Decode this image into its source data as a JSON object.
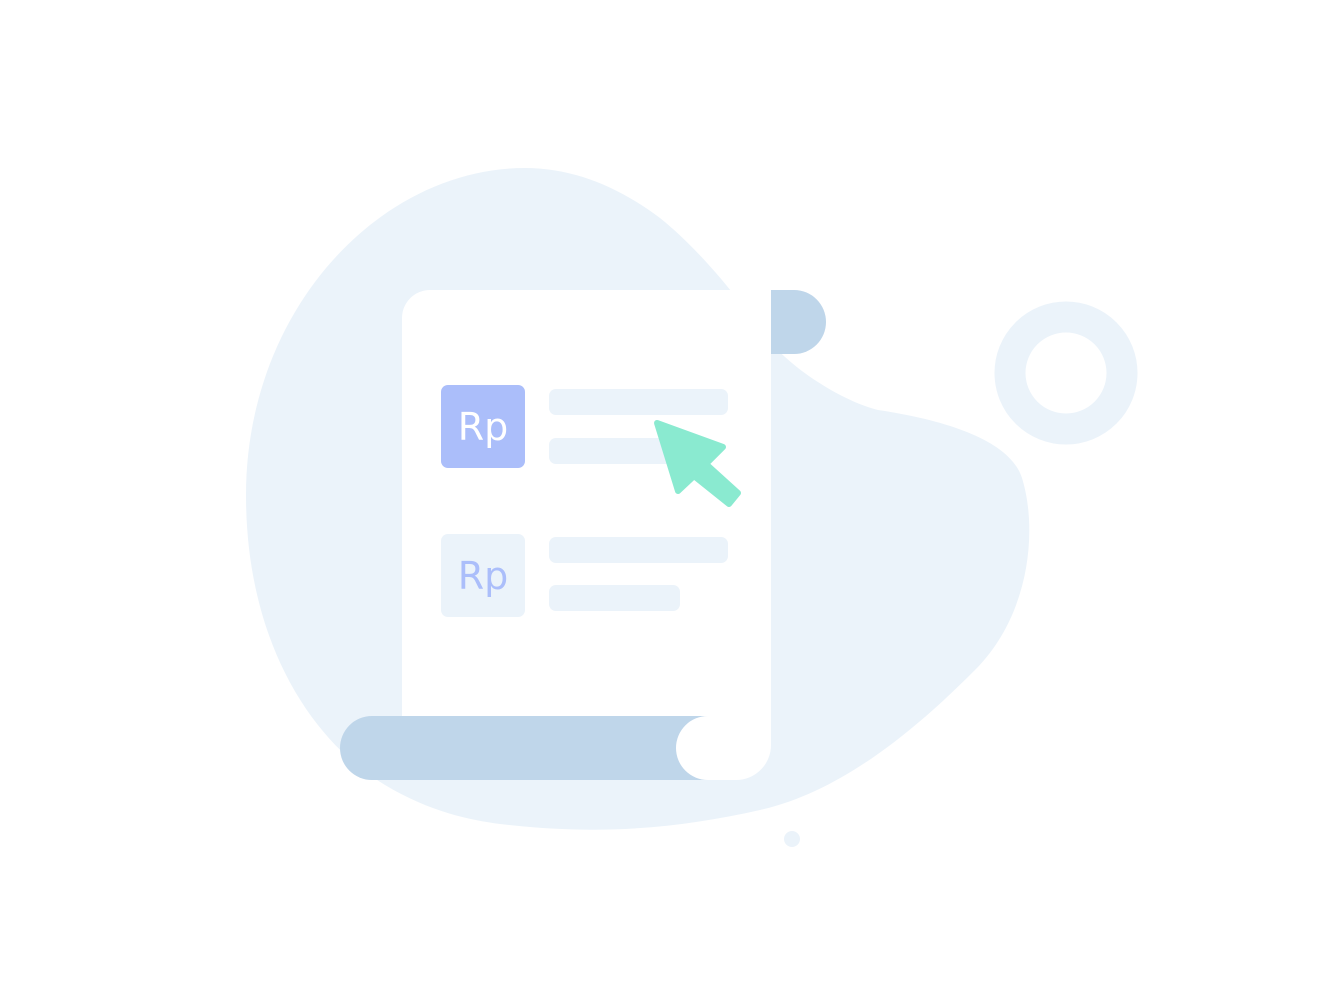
{
  "items": [
    {
      "icon_label": "Rp",
      "state": "selected"
    },
    {
      "icon_label": "Rp",
      "state": "default"
    }
  ],
  "colors": {
    "background": "#ffffff",
    "blob": "#ebf3fa",
    "paper": "#ffffff",
    "roll": "#bfd6ea",
    "ring": "#ebf3fa",
    "icon_selected_bg": "#abbefa",
    "icon_selected_text": "#ffffff",
    "icon_default_bg": "#ebf3fa",
    "icon_default_text": "#abbefa",
    "placeholder_line": "#ebf3fa",
    "cursor": "#8aead0"
  },
  "icons": {
    "cursor": "pointer-arrow-icon",
    "ring": "ring-decoration",
    "dot": "dot-decoration"
  }
}
